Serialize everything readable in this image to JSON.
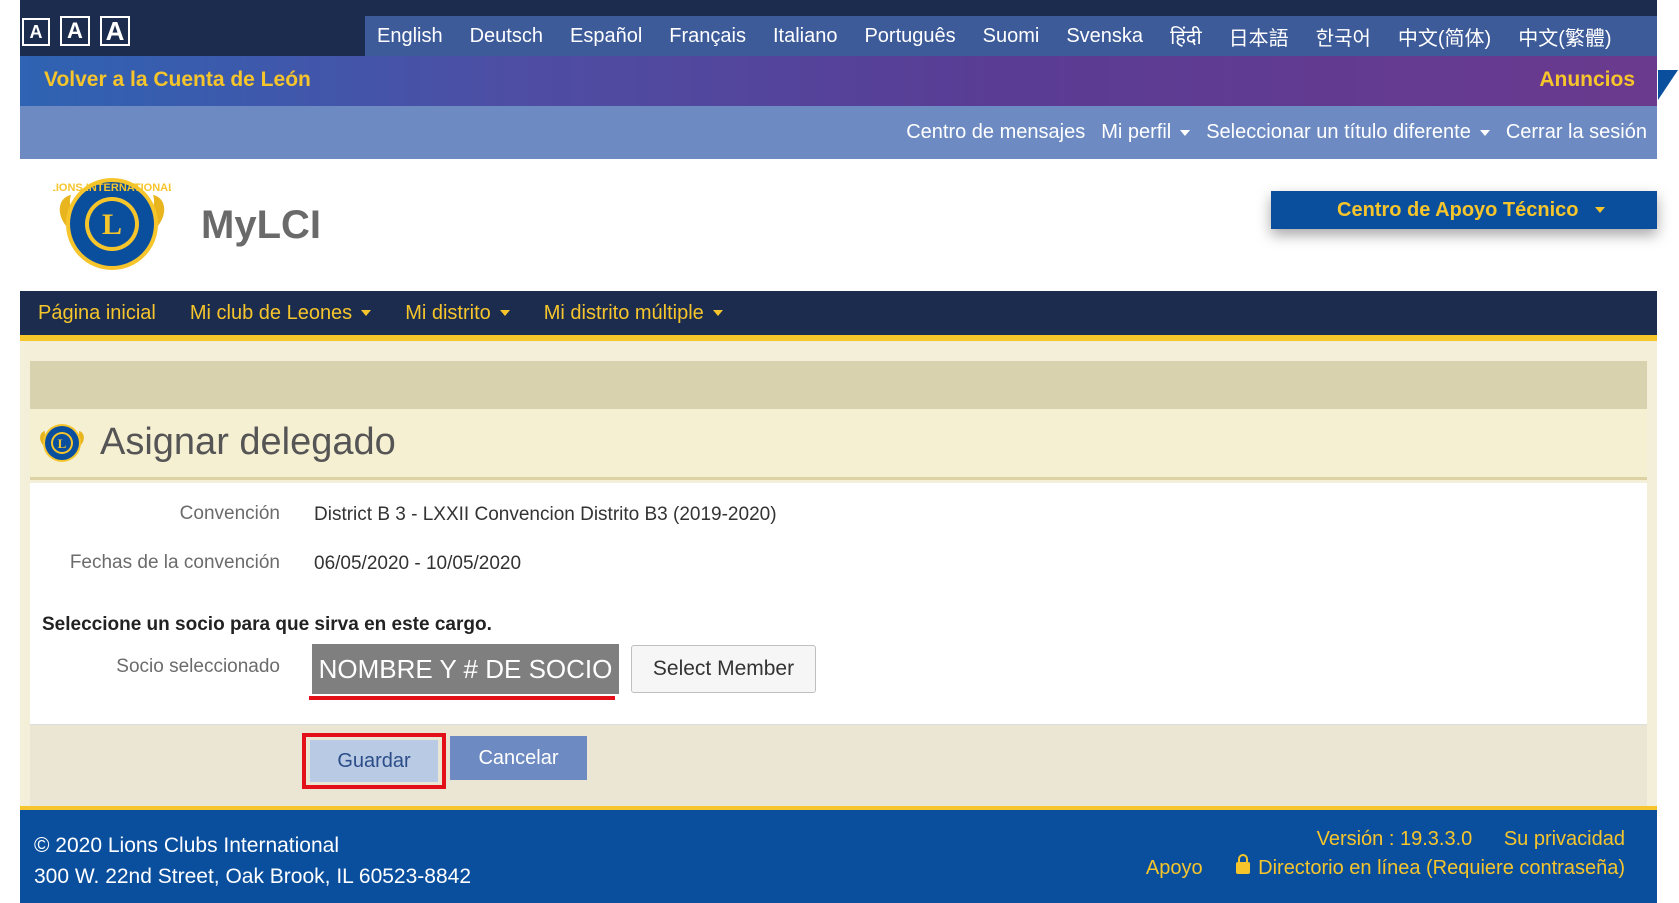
{
  "font_size_controls": [
    "A",
    "A",
    "A"
  ],
  "languages": [
    "English",
    "Deutsch",
    "Español",
    "Français",
    "Italiano",
    "Português",
    "Suomi",
    "Svenska",
    "हिंदी",
    "日本語",
    "한국어",
    "中文(简体)",
    "中文(繁體)"
  ],
  "banner": {
    "back_link": "Volver a la Cuenta de León",
    "announcements": "Anuncios"
  },
  "user_menu": {
    "messages": "Centro de mensajes",
    "profile": "Mi perfil",
    "select_title": "Seleccionar un título diferente",
    "logout": "Cerrar la sesión"
  },
  "header": {
    "logo_text": "LIONS INTERNATIONAL",
    "app_title": "MyLCI",
    "support_center": "Centro de Apoyo Técnico"
  },
  "main_nav": {
    "home": "Página inicial",
    "my_club": "Mi club de Leones",
    "my_district": "Mi distrito",
    "my_multiple_district": "Mi distrito múltiple"
  },
  "page": {
    "title": "Asignar delegado",
    "convention_label": "Convención",
    "convention_value": "District B 3 - LXXII Convencion Distrito B3 (2019-2020)",
    "dates_label": "Fechas de la convención",
    "dates_value": "06/05/2020 - 10/05/2020",
    "instruction": "Seleccione un socio para que sirva en este cargo.",
    "selected_member_label": "Socio seleccionado",
    "selected_member_value": "NOMBRE Y # DE SOCIO",
    "select_member_button": "Select Member",
    "save_button": "Guardar",
    "cancel_button": "Cancelar"
  },
  "footer": {
    "copyright": "© 2020 Lions Clubs International",
    "address": "300 W. 22nd Street, Oak Brook, IL 60523-8842",
    "version": "Versión : 19.3.3.0",
    "privacy": "Su privacidad",
    "support": "Apoyo",
    "directory": "Directorio en línea (Requiere contraseña)"
  },
  "colors": {
    "navy": "#1b2c4f",
    "gold": "#f6c52b",
    "footer_blue": "#0a4f9e",
    "highlight_red": "#e3101a"
  }
}
